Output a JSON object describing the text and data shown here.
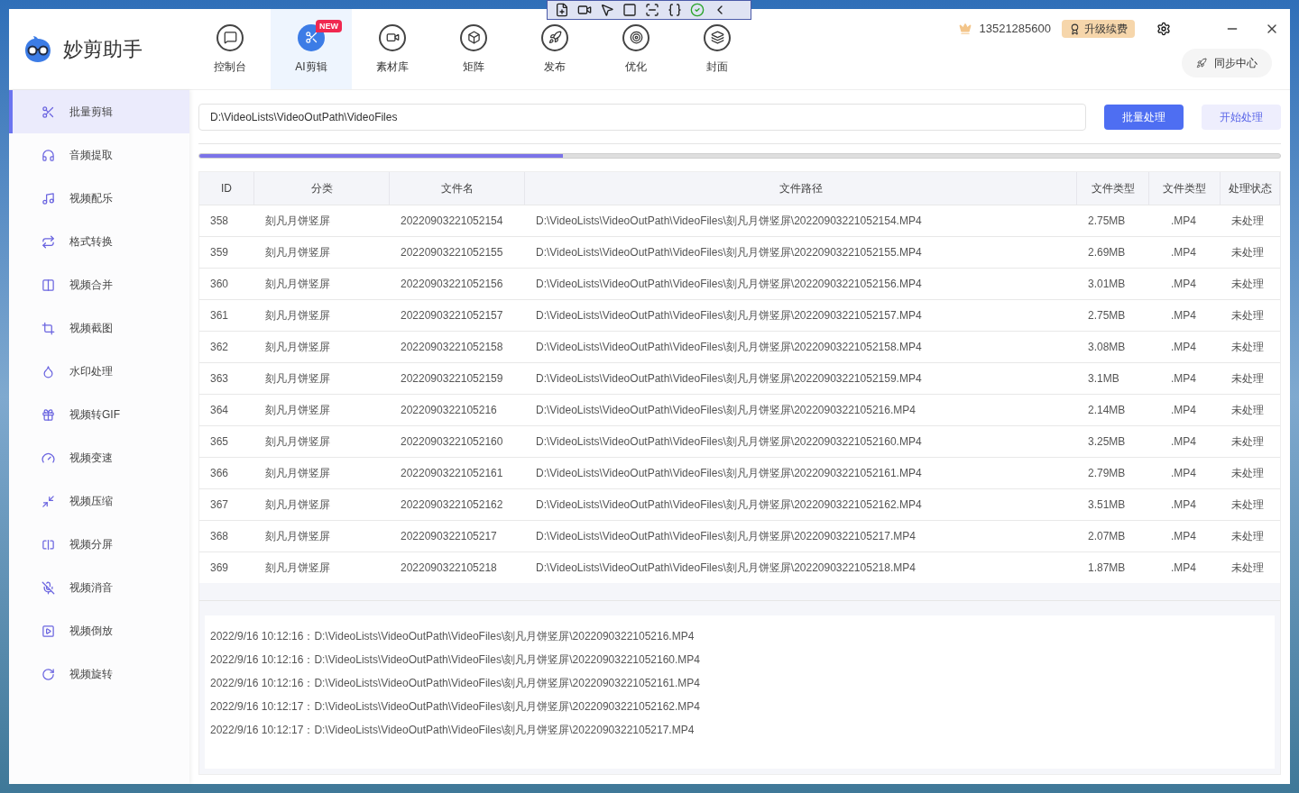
{
  "app": {
    "name": "妙剪助手"
  },
  "nav_tabs": [
    {
      "label": "控制台",
      "selected": false
    },
    {
      "label": "AI剪辑",
      "selected": true,
      "badge": "NEW"
    },
    {
      "label": "素材库",
      "selected": false
    },
    {
      "label": "矩阵",
      "selected": false
    },
    {
      "label": "发布",
      "selected": false
    },
    {
      "label": "优化",
      "selected": false
    },
    {
      "label": "封面",
      "selected": false
    }
  ],
  "account": {
    "phone": "13521285600",
    "upgrade_button": "升级续费",
    "sync_button": "同步中心"
  },
  "sidebar": {
    "items": [
      {
        "label": "批量剪辑",
        "selected": true
      },
      {
        "label": "音频提取",
        "selected": false
      },
      {
        "label": "视频配乐",
        "selected": false
      },
      {
        "label": "格式转换",
        "selected": false
      },
      {
        "label": "视频合并",
        "selected": false
      },
      {
        "label": "视频截图",
        "selected": false
      },
      {
        "label": "水印处理",
        "selected": false
      },
      {
        "label": "视频转GIF",
        "selected": false
      },
      {
        "label": "视频变速",
        "selected": false
      },
      {
        "label": "视频压缩",
        "selected": false
      },
      {
        "label": "视频分屏",
        "selected": false
      },
      {
        "label": "视频消音",
        "selected": false
      },
      {
        "label": "视频倒放",
        "selected": false
      },
      {
        "label": "视频旋转",
        "selected": false
      }
    ]
  },
  "path_field": {
    "value": "D:\\VideoLists\\VideoOutPath\\VideoFiles"
  },
  "buttons": {
    "batch": "批量处理",
    "start": "开始处理"
  },
  "progress": {
    "level": 0.336
  },
  "table": {
    "columns": [
      "ID",
      "分类",
      "文件名",
      "文件路径",
      "文件类型",
      "文件类型",
      "处理状态"
    ],
    "rows": [
      [
        "358",
        "刻凡月饼竖屏",
        "20220903221052154",
        "D:\\VideoLists\\VideoOutPath\\VideoFiles\\刻凡月饼竖屏\\20220903221052154.MP4",
        "2.75MB",
        ".MP4",
        "未处理"
      ],
      [
        "359",
        "刻凡月饼竖屏",
        "20220903221052155",
        "D:\\VideoLists\\VideoOutPath\\VideoFiles\\刻凡月饼竖屏\\20220903221052155.MP4",
        "2.69MB",
        ".MP4",
        "未处理"
      ],
      [
        "360",
        "刻凡月饼竖屏",
        "20220903221052156",
        "D:\\VideoLists\\VideoOutPath\\VideoFiles\\刻凡月饼竖屏\\20220903221052156.MP4",
        "3.01MB",
        ".MP4",
        "未处理"
      ],
      [
        "361",
        "刻凡月饼竖屏",
        "20220903221052157",
        "D:\\VideoLists\\VideoOutPath\\VideoFiles\\刻凡月饼竖屏\\20220903221052157.MP4",
        "2.75MB",
        ".MP4",
        "未处理"
      ],
      [
        "362",
        "刻凡月饼竖屏",
        "20220903221052158",
        "D:\\VideoLists\\VideoOutPath\\VideoFiles\\刻凡月饼竖屏\\20220903221052158.MP4",
        "3.08MB",
        ".MP4",
        "未处理"
      ],
      [
        "363",
        "刻凡月饼竖屏",
        "20220903221052159",
        "D:\\VideoLists\\VideoOutPath\\VideoFiles\\刻凡月饼竖屏\\20220903221052159.MP4",
        "3.1MB",
        ".MP4",
        "未处理"
      ],
      [
        "364",
        "刻凡月饼竖屏",
        "2022090322105216",
        "D:\\VideoLists\\VideoOutPath\\VideoFiles\\刻凡月饼竖屏\\2022090322105216.MP4",
        "2.14MB",
        ".MP4",
        "未处理"
      ],
      [
        "365",
        "刻凡月饼竖屏",
        "20220903221052160",
        "D:\\VideoLists\\VideoOutPath\\VideoFiles\\刻凡月饼竖屏\\20220903221052160.MP4",
        "3.25MB",
        ".MP4",
        "未处理"
      ],
      [
        "366",
        "刻凡月饼竖屏",
        "20220903221052161",
        "D:\\VideoLists\\VideoOutPath\\VideoFiles\\刻凡月饼竖屏\\20220903221052161.MP4",
        "2.79MB",
        ".MP4",
        "未处理"
      ],
      [
        "367",
        "刻凡月饼竖屏",
        "20220903221052162",
        "D:\\VideoLists\\VideoOutPath\\VideoFiles\\刻凡月饼竖屏\\20220903221052162.MP4",
        "3.51MB",
        ".MP4",
        "未处理"
      ],
      [
        "368",
        "刻凡月饼竖屏",
        "2022090322105217",
        "D:\\VideoLists\\VideoOutPath\\VideoFiles\\刻凡月饼竖屏\\2022090322105217.MP4",
        "2.07MB",
        ".MP4",
        "未处理"
      ],
      [
        "369",
        "刻凡月饼竖屏",
        "2022090322105218",
        "D:\\VideoLists\\VideoOutPath\\VideoFiles\\刻凡月饼竖屏\\2022090322105218.MP4",
        "1.87MB",
        ".MP4",
        "未处理"
      ]
    ]
  },
  "log": [
    "2022/9/16 10:12:16：D:\\VideoLists\\VideoOutPath\\VideoFiles\\刻凡月饼竖屏\\2022090322105216.MP4",
    "2022/9/16 10:12:16：D:\\VideoLists\\VideoOutPath\\VideoFiles\\刻凡月饼竖屏\\20220903221052160.MP4",
    "2022/9/16 10:12:16：D:\\VideoLists\\VideoOutPath\\VideoFiles\\刻凡月饼竖屏\\20220903221052161.MP4",
    "2022/9/16 10:12:17：D:\\VideoLists\\VideoOutPath\\VideoFiles\\刻凡月饼竖屏\\20220903221052162.MP4",
    "2022/9/16 10:12:17：D:\\VideoLists\\VideoOutPath\\VideoFiles\\刻凡月饼竖屏\\2022090322105217.MP4"
  ]
}
